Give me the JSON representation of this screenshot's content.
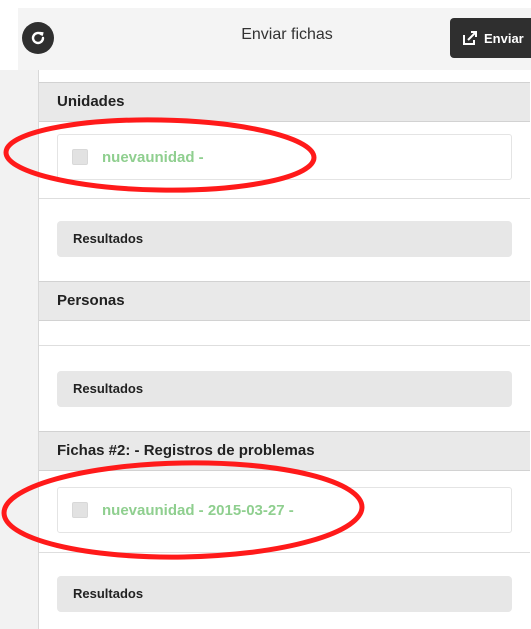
{
  "header": {
    "title": "Enviar fichas",
    "send_label": "Enviar"
  },
  "sections": {
    "unidades": {
      "title": "Unidades",
      "item": "nuevaunidad -",
      "results_label": "Resultados"
    },
    "personas": {
      "title": "Personas",
      "results_label": "Resultados"
    },
    "fichas": {
      "title": "Fichas #2: - Registros de problemas",
      "item": "nuevaunidad - 2015-03-27 -",
      "results_label": "Resultados"
    }
  },
  "colors": {
    "accent_dark": "#2f2f2f",
    "item_text": "#8fcf8f",
    "annotation_red": "#ff1a1a"
  },
  "icons": {
    "refresh": "refresh-icon",
    "send": "share-out-icon"
  }
}
